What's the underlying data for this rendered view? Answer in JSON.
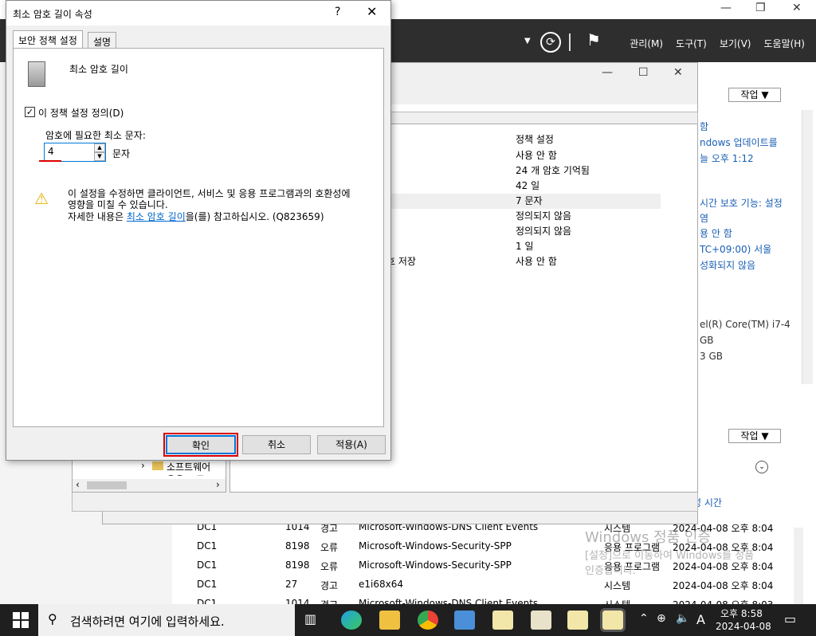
{
  "server_manager": {
    "menu": [
      "관리(M)",
      "도구(T)",
      "보기(V)",
      "도움말(H)"
    ],
    "right_pane_lines": [
      "함",
      "ndows 업데이트를",
      "늘 오후 1:12",
      "시간 보호 기능: 설정",
      "염",
      "용 안 함",
      "TC+09:00) 서울",
      "성화되지 않음",
      "el(R) Core(TM) i7-4",
      "GB",
      "3 GB"
    ],
    "task_label": "작업",
    "time_header": "생성 시간"
  },
  "events": [
    {
      "server": "DC1",
      "id": "1014",
      "level": "경고",
      "source": "Microsoft-Windows-DNS Client Events",
      "log": "시스템",
      "time": "2024-04-08 오후 8:04"
    },
    {
      "server": "DC1",
      "id": "8198",
      "level": "오류",
      "source": "Microsoft-Windows-Security-SPP",
      "log": "응용 프로그램",
      "time": "2024-04-08 오후 8:04"
    },
    {
      "server": "DC1",
      "id": "8198",
      "level": "오류",
      "source": "Microsoft-Windows-Security-SPP",
      "log": "응용 프로그램",
      "time": "2024-04-08 오후 8:04"
    },
    {
      "server": "DC1",
      "id": "27",
      "level": "경고",
      "source": "e1i68x64",
      "log": "시스템",
      "time": "2024-04-08 오후 8:04"
    },
    {
      "server": "DC1",
      "id": "1014",
      "level": "경고",
      "source": "Microsoft-Windows-DNS Client Events",
      "log": "시스템",
      "time": "2024-04-08 오후 8:03"
    }
  ],
  "policy_list": {
    "column_header": "정책 설정",
    "rows": [
      {
        "name": "",
        "value": "사용 안 함"
      },
      {
        "name": "",
        "value": "24 개 암호 기억됨"
      },
      {
        "name": "",
        "value": "42 일"
      },
      {
        "name": "",
        "value": "7 문자"
      },
      {
        "name": "",
        "value": "정의되지 않음"
      },
      {
        "name": "",
        "value": "정의되지 않음"
      },
      {
        "name": "",
        "value": "1 일"
      },
      {
        "name": "호 저장",
        "value": "사용 안 함"
      }
    ]
  },
  "tree": {
    "items": [
      "소프트웨어",
      "응용 프로"
    ]
  },
  "watermark": {
    "line1": "Windows 정품 인증",
    "line2": "[설정]으로 이동하여 Windows를 정품",
    "line3": "인증합니다."
  },
  "dialog": {
    "title": "최소 암호 길이 속성",
    "help": "?",
    "tabs": [
      "보안 정책 설정",
      "설명"
    ],
    "policy_name": "최소 암호 길이",
    "define_checkbox": "이 정책 설정 정의(D)",
    "min_chars_label": "암호에 필요한 최소 문자:",
    "spinner_value": "4",
    "unit": "문자",
    "warning_line1": "이 설정을 수정하면 클라이언트, 서비스 및 응용 프로그램과의 호환성에",
    "warning_line2": "영향을 미칠 수 있습니다.",
    "warning_prefix": "자세한 내용은 ",
    "warning_link": "최소 암호 길이",
    "warning_suffix": "을(를) 참고하십시오. (Q823659)",
    "ok": "확인",
    "cancel": "취소",
    "apply": "적용(A)"
  },
  "taskbar": {
    "search_placeholder": "검색하려면 여기에 입력하세요.",
    "time": "오후 8:58",
    "date": "2024-04-08",
    "ime": "A"
  }
}
